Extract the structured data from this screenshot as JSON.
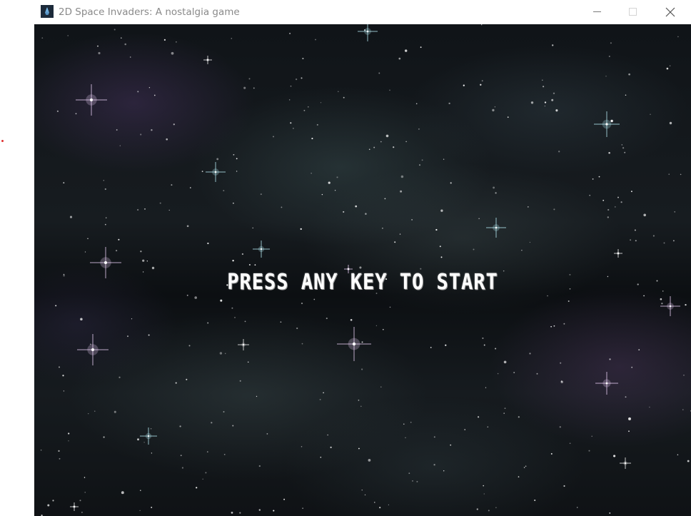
{
  "window": {
    "title": "2D Space Invaders: A nostalgia game",
    "app_icon": "space-invaders-app-icon",
    "controls": {
      "minimize_icon": "minimize-icon",
      "maximize_icon": "maximize-icon",
      "close_icon": "close-icon"
    }
  },
  "game": {
    "prompt": "PRESS ANY KEY TO START",
    "background": "starfield-nebula"
  },
  "colors": {
    "prompt_text": "#ffffff",
    "titlebar_bg": "#ffffff",
    "title_text": "#8a8a8a",
    "stray_dot": "#e03030",
    "star_white": "#ffffff",
    "star_cyan": "#bff6ff",
    "star_pink": "#f3d8ff"
  }
}
